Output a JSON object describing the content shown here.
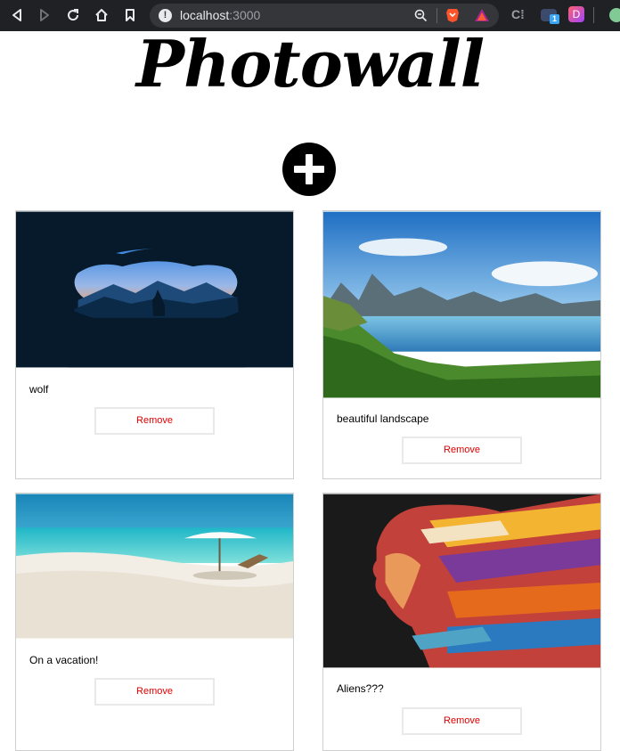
{
  "browser": {
    "url_host": "localhost",
    "url_port": ":3000",
    "extension_badge": "1",
    "extension_letter": "D"
  },
  "page": {
    "title": "Photowall",
    "add_icon": "plus-icon"
  },
  "posts": [
    {
      "caption": "wolf",
      "remove_label": "Remove",
      "image": "wolf-cave-illustration"
    },
    {
      "caption": "beautiful landscape",
      "remove_label": "Remove",
      "image": "lake-mountain-landscape"
    },
    {
      "caption": "On a vacation!",
      "remove_label": "Remove",
      "image": "beach-umbrella"
    },
    {
      "caption": "Aliens???",
      "remove_label": "Remove",
      "image": "colorful-face-art"
    }
  ],
  "colors": {
    "chrome": "#202124",
    "remove_text": "#e00000",
    "card_border": "#cfcfcf"
  }
}
